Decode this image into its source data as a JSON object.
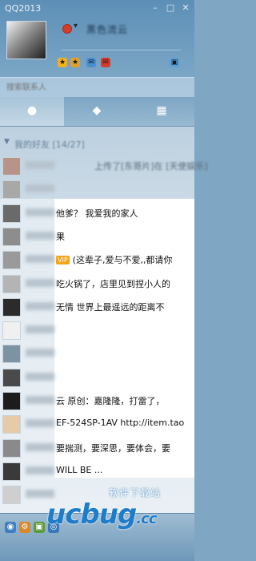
{
  "window": {
    "title": "QQ2013"
  },
  "profile": {
    "nickname": "黑色流云"
  },
  "search": {
    "placeholder": "搜索联系人"
  },
  "tabs": [
    {
      "icon": "contacts-icon",
      "active": true
    },
    {
      "icon": "chat-bubble-icon",
      "active": false
    },
    {
      "icon": "grid-icon",
      "active": false
    }
  ],
  "contacts": {
    "group_label": "我的好友 [14/27]",
    "items": [
      {
        "message": "上传了[东哥片]在 [天使娱乐]",
        "avatar_color": "#b8938a"
      },
      {
        "message": "",
        "avatar_color": "#a8a8a8"
      },
      {
        "message": "他爹？  我爱我的家人",
        "avatar_color": "#6a6a6a"
      },
      {
        "message": "果",
        "avatar_color": "#8d8d8d"
      },
      {
        "vip": "VIP",
        "message": "(这辈子,爱与不爱,,都请你",
        "avatar_color": "#9a9a9a"
      },
      {
        "message": "吃火锅了，店里见到捏小人的",
        "avatar_color": "#b4b4b4"
      },
      {
        "message": "无情  世界上最遥远的距离不",
        "avatar_color": "#2b2b2b"
      },
      {
        "message": "",
        "avatar_color": "#f0f0f0"
      },
      {
        "message": "",
        "avatar_color": "#7c93a4"
      },
      {
        "message": "",
        "avatar_color": "#4a4a4a"
      },
      {
        "message": "云  原创：嘉隆隆，打雷了，",
        "avatar_color": "#1c1c1c"
      },
      {
        "message": "EF-524SP-1AV  http://item.tao",
        "avatar_color": "#e8c9a8"
      },
      {
        "message": "要揣测，要深思，要体会，要",
        "avatar_color": "#8a8a8a"
      },
      {
        "message": "WILL BE ...",
        "avatar_color": "#3a3a3a"
      },
      {
        "message": "",
        "avatar_color": "#cfcfcf"
      }
    ]
  },
  "watermark": {
    "line1": "软件下载站",
    "logo": "ucbug",
    "suffix": ".cc"
  },
  "colors": {
    "accent": "#1f7cc8",
    "vip": "#f3a417",
    "titlebar": "#5d8fb6"
  }
}
